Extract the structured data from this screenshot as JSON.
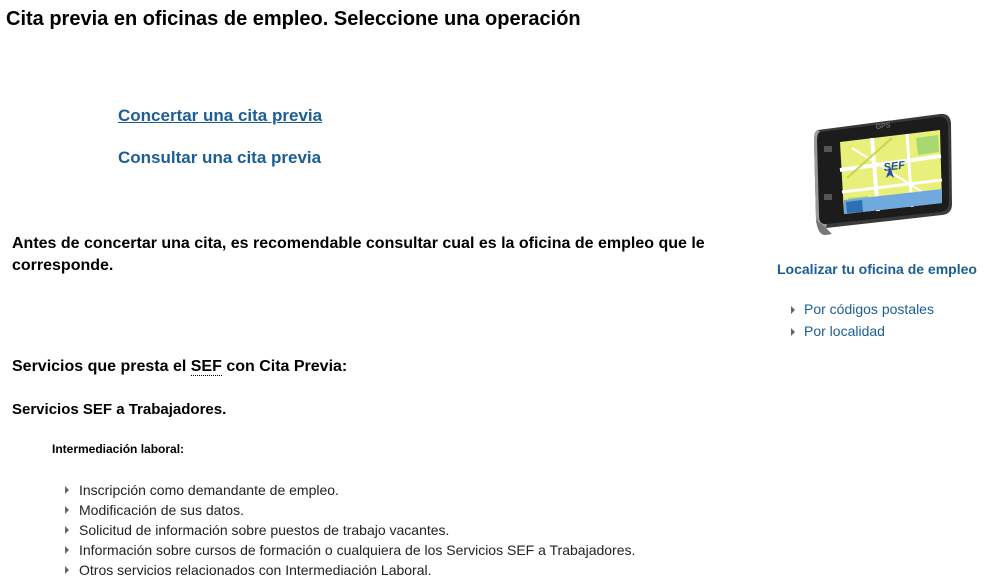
{
  "page": {
    "title": "Cita previa en oficinas de empleo. Seleccione una operación"
  },
  "operations": {
    "concertar": "Concertar una cita previa",
    "consultar": "Consultar una cita previa"
  },
  "advice": "Antes de concertar una cita, es recomendable consultar cual es la oficina de empleo que le corresponde.",
  "services": {
    "title_before": "Servicios que presta el ",
    "title_abbr": "SEF",
    "title_after": " con Cita Previa:",
    "workers_title": "Servicios SEF a Trabajadores.",
    "intermediation_title": "Intermediación laboral:",
    "items": [
      "Inscripción como demandante de empleo.",
      "Modificación de sus datos.",
      "Solicitud de información sobre puestos de trabajo vacantes.",
      "Información sobre cursos de formación o cualquiera de los Servicios SEF a Trabajadores.",
      "Otros servicios relacionados con Intermediación Laboral."
    ]
  },
  "sidebar": {
    "device_label": "GPS",
    "device_logo": "SEF",
    "device_icon": "gps-device-icon",
    "title": "Localizar tu oficina de empleo",
    "links": [
      "Por códigos postales",
      "Por localidad"
    ]
  },
  "colors": {
    "link": "#1b5e96",
    "text": "#000000",
    "bullet": "#666666"
  }
}
